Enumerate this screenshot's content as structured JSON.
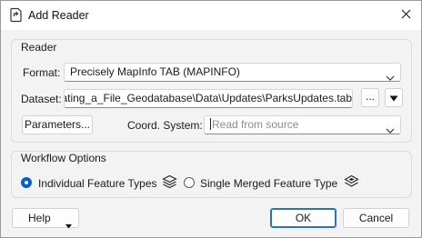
{
  "window": {
    "title": "Add Reader",
    "close_glyph": "✕"
  },
  "reader_group": {
    "title": "Reader",
    "format_label": "Format:",
    "format_value": "Precisely MapInfo TAB (MAPINFO)",
    "dataset_label": "Dataset:",
    "dataset_value": "dating_a_File_Geodatabase\\Data\\Updates\\ParksUpdates.tab",
    "browse_label": "...",
    "parameters_label": "Parameters...",
    "coord_label": "Coord. System:",
    "coord_placeholder": "Read from source"
  },
  "workflow_group": {
    "title": "Workflow Options",
    "option_individual": "Individual Feature Types",
    "option_merged": "Single Merged Feature Type",
    "selected": "individual"
  },
  "footer": {
    "help_label": "Help",
    "ok_label": "OK",
    "cancel_label": "Cancel"
  },
  "colors": {
    "accent": "#0a5fc6",
    "primary_border": "#2a6fc9"
  },
  "icons": {
    "title": "reader-app-icon",
    "close": "close-icon",
    "dropdown": "chevron-down-icon",
    "dataset_menu": "triangle-down-icon",
    "individual": "layers-stack-icon",
    "merged": "merged-layers-icon"
  }
}
